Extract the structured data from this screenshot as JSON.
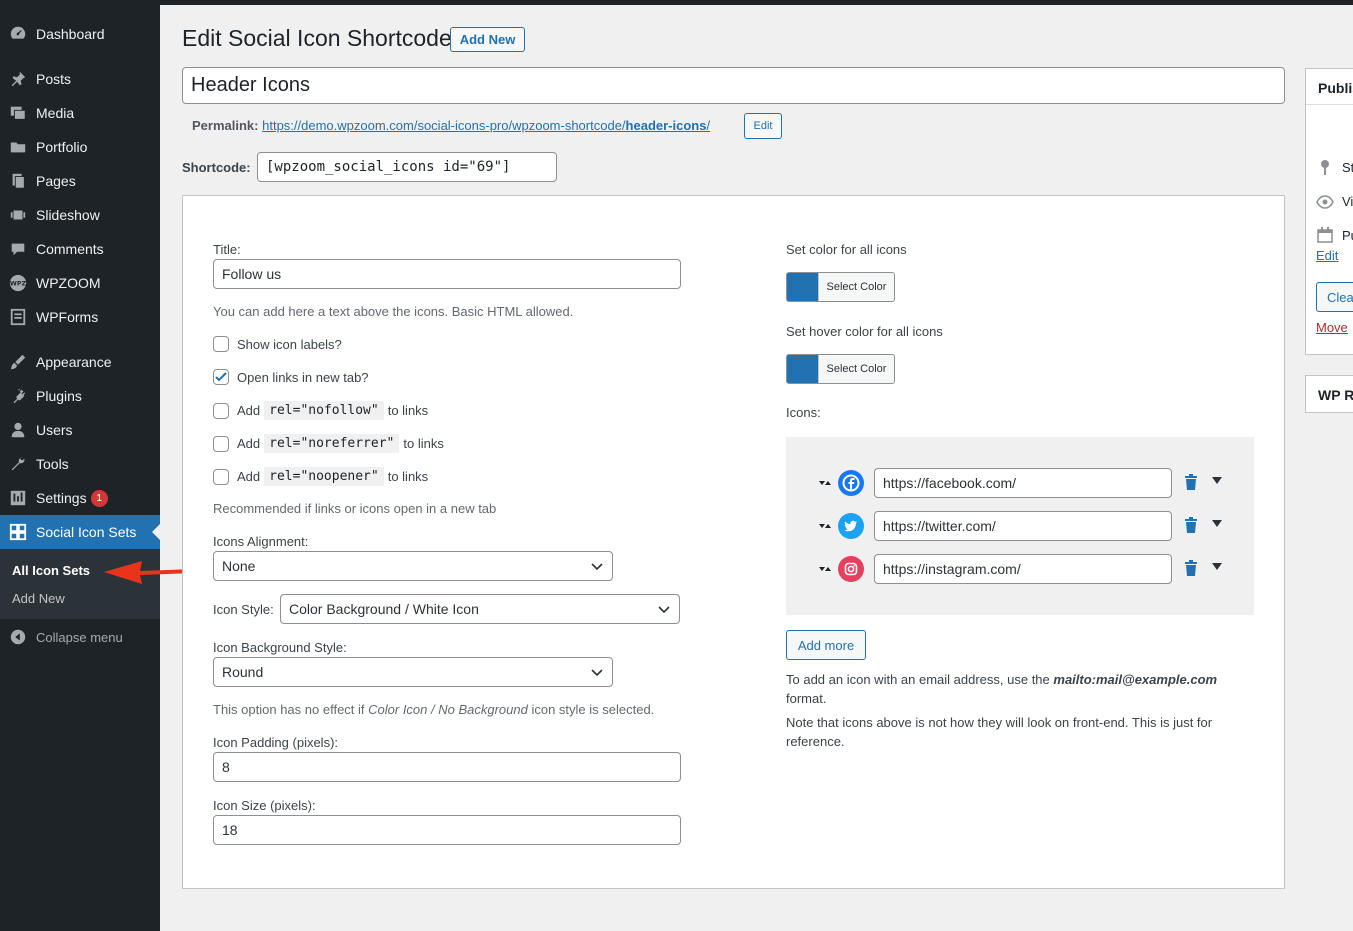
{
  "sidebar": {
    "items": [
      {
        "label": "Dashboard",
        "icon": "dashboard-icon"
      },
      {
        "label": "Posts",
        "icon": "pin-icon"
      },
      {
        "label": "Media",
        "icon": "media-icon"
      },
      {
        "label": "Portfolio",
        "icon": "folder-icon"
      },
      {
        "label": "Pages",
        "icon": "pages-icon"
      },
      {
        "label": "Slideshow",
        "icon": "slides-icon"
      },
      {
        "label": "Comments",
        "icon": "comment-icon"
      },
      {
        "label": "WPZOOM",
        "icon": "wpzoom-logo-icon"
      },
      {
        "label": "WPForms",
        "icon": "forms-icon"
      },
      {
        "label": "Appearance",
        "icon": "brush-icon"
      },
      {
        "label": "Plugins",
        "icon": "plug-icon"
      },
      {
        "label": "Users",
        "icon": "user-icon"
      },
      {
        "label": "Tools",
        "icon": "wrench-icon"
      },
      {
        "label": "Settings",
        "icon": "settings-icon",
        "badge": "1"
      },
      {
        "label": "Social Icon Sets",
        "icon": "grid-icon",
        "active": true
      }
    ],
    "submenu": [
      "All Icon Sets",
      "Add New"
    ],
    "collapse": "Collapse menu"
  },
  "header": {
    "title": "Edit Social Icon Shortcode",
    "add_new": "Add New"
  },
  "post_title": "Header Icons",
  "permalink": {
    "label": "Permalink:",
    "base": "https://demo.wpzoom.com/social-icons-pro/wpzoom-shortcode/",
    "slug": "header-icons",
    "trail": "/",
    "edit": "Edit"
  },
  "shortcode": {
    "label": "Shortcode:",
    "value": "[wpzoom_social_icons id=\"69\"]"
  },
  "form": {
    "title_label": "Title:",
    "title_value": "Follow us",
    "title_help": "You can add here a text above the icons. Basic HTML allowed.",
    "show_labels": "Show icon labels?",
    "open_new_tab": "Open links in new tab?",
    "add_word": "Add",
    "to_links": "to links",
    "rel_nofollow": "rel=\"nofollow\"",
    "rel_noreferrer": "rel=\"noreferrer\"",
    "rel_noopener": "rel=\"noopener\"",
    "recommended": "Recommended if links or icons open in a new tab",
    "alignment_label": "Icons Alignment:",
    "alignment_value": "None",
    "style_label": "Icon Style:",
    "style_value": "Color Background / White Icon",
    "bg_style_label": "Icon Background Style:",
    "bg_style_value": "Round",
    "bg_note_pre": "This option has no effect if ",
    "bg_note_em": "Color Icon / No Background",
    "bg_note_post": " icon style is selected.",
    "padding_label": "Icon Padding (pixels):",
    "padding_value": "8",
    "size_label": "Icon Size (pixels):",
    "size_value": "18"
  },
  "colors_section": {
    "all_label": "Set color for all icons",
    "hover_label": "Set hover color for all icons",
    "select_color": "Select Color",
    "swatch": "#2271b1"
  },
  "icons_section": {
    "label": "Icons:",
    "items": [
      {
        "url": "https://facebook.com/",
        "icon": "facebook-icon",
        "color": "#1877f2"
      },
      {
        "url": "https://twitter.com/",
        "icon": "twitter-icon",
        "color": "#1da1f2"
      },
      {
        "url": "https://instagram.com/",
        "icon": "instagram-icon",
        "color": "#e4405f"
      }
    ],
    "add_more": "Add more",
    "email_note_pre": "To add an icon with an email address, use the ",
    "email_note_em": "mailto:mail@example.com",
    "email_note_post": "format.",
    "frontend_note_1": "Note that icons above is not how they will look on front-end. This is just for",
    "frontend_note_2": "reference."
  },
  "publish_box": {
    "title": "Publis",
    "status": "St",
    "visibility": "Vi",
    "published": "Pu",
    "edit": "Edit",
    "clear": "Clea",
    "move": "Move"
  },
  "second_box": {
    "title": "WP R"
  }
}
